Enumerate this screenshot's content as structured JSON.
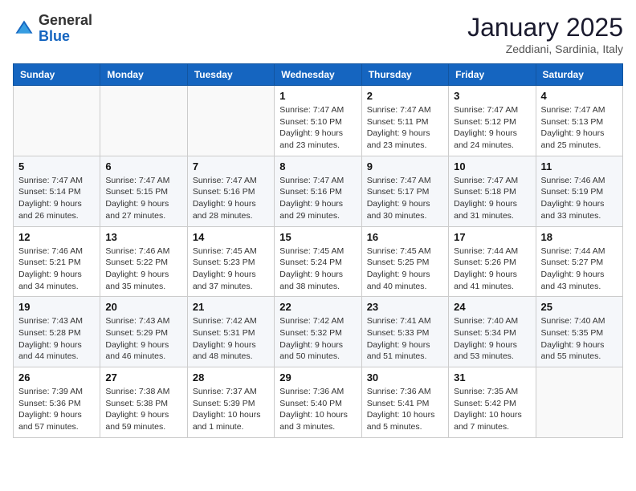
{
  "header": {
    "logo_general": "General",
    "logo_blue": "Blue",
    "month_title": "January 2025",
    "location": "Zeddiani, Sardinia, Italy"
  },
  "weekdays": [
    "Sunday",
    "Monday",
    "Tuesday",
    "Wednesday",
    "Thursday",
    "Friday",
    "Saturday"
  ],
  "weeks": [
    [
      {
        "day": "",
        "info": ""
      },
      {
        "day": "",
        "info": ""
      },
      {
        "day": "",
        "info": ""
      },
      {
        "day": "1",
        "info": "Sunrise: 7:47 AM\nSunset: 5:10 PM\nDaylight: 9 hours and 23 minutes."
      },
      {
        "day": "2",
        "info": "Sunrise: 7:47 AM\nSunset: 5:11 PM\nDaylight: 9 hours and 23 minutes."
      },
      {
        "day": "3",
        "info": "Sunrise: 7:47 AM\nSunset: 5:12 PM\nDaylight: 9 hours and 24 minutes."
      },
      {
        "day": "4",
        "info": "Sunrise: 7:47 AM\nSunset: 5:13 PM\nDaylight: 9 hours and 25 minutes."
      }
    ],
    [
      {
        "day": "5",
        "info": "Sunrise: 7:47 AM\nSunset: 5:14 PM\nDaylight: 9 hours and 26 minutes."
      },
      {
        "day": "6",
        "info": "Sunrise: 7:47 AM\nSunset: 5:15 PM\nDaylight: 9 hours and 27 minutes."
      },
      {
        "day": "7",
        "info": "Sunrise: 7:47 AM\nSunset: 5:16 PM\nDaylight: 9 hours and 28 minutes."
      },
      {
        "day": "8",
        "info": "Sunrise: 7:47 AM\nSunset: 5:16 PM\nDaylight: 9 hours and 29 minutes."
      },
      {
        "day": "9",
        "info": "Sunrise: 7:47 AM\nSunset: 5:17 PM\nDaylight: 9 hours and 30 minutes."
      },
      {
        "day": "10",
        "info": "Sunrise: 7:47 AM\nSunset: 5:18 PM\nDaylight: 9 hours and 31 minutes."
      },
      {
        "day": "11",
        "info": "Sunrise: 7:46 AM\nSunset: 5:19 PM\nDaylight: 9 hours and 33 minutes."
      }
    ],
    [
      {
        "day": "12",
        "info": "Sunrise: 7:46 AM\nSunset: 5:21 PM\nDaylight: 9 hours and 34 minutes."
      },
      {
        "day": "13",
        "info": "Sunrise: 7:46 AM\nSunset: 5:22 PM\nDaylight: 9 hours and 35 minutes."
      },
      {
        "day": "14",
        "info": "Sunrise: 7:45 AM\nSunset: 5:23 PM\nDaylight: 9 hours and 37 minutes."
      },
      {
        "day": "15",
        "info": "Sunrise: 7:45 AM\nSunset: 5:24 PM\nDaylight: 9 hours and 38 minutes."
      },
      {
        "day": "16",
        "info": "Sunrise: 7:45 AM\nSunset: 5:25 PM\nDaylight: 9 hours and 40 minutes."
      },
      {
        "day": "17",
        "info": "Sunrise: 7:44 AM\nSunset: 5:26 PM\nDaylight: 9 hours and 41 minutes."
      },
      {
        "day": "18",
        "info": "Sunrise: 7:44 AM\nSunset: 5:27 PM\nDaylight: 9 hours and 43 minutes."
      }
    ],
    [
      {
        "day": "19",
        "info": "Sunrise: 7:43 AM\nSunset: 5:28 PM\nDaylight: 9 hours and 44 minutes."
      },
      {
        "day": "20",
        "info": "Sunrise: 7:43 AM\nSunset: 5:29 PM\nDaylight: 9 hours and 46 minutes."
      },
      {
        "day": "21",
        "info": "Sunrise: 7:42 AM\nSunset: 5:31 PM\nDaylight: 9 hours and 48 minutes."
      },
      {
        "day": "22",
        "info": "Sunrise: 7:42 AM\nSunset: 5:32 PM\nDaylight: 9 hours and 50 minutes."
      },
      {
        "day": "23",
        "info": "Sunrise: 7:41 AM\nSunset: 5:33 PM\nDaylight: 9 hours and 51 minutes."
      },
      {
        "day": "24",
        "info": "Sunrise: 7:40 AM\nSunset: 5:34 PM\nDaylight: 9 hours and 53 minutes."
      },
      {
        "day": "25",
        "info": "Sunrise: 7:40 AM\nSunset: 5:35 PM\nDaylight: 9 hours and 55 minutes."
      }
    ],
    [
      {
        "day": "26",
        "info": "Sunrise: 7:39 AM\nSunset: 5:36 PM\nDaylight: 9 hours and 57 minutes."
      },
      {
        "day": "27",
        "info": "Sunrise: 7:38 AM\nSunset: 5:38 PM\nDaylight: 9 hours and 59 minutes."
      },
      {
        "day": "28",
        "info": "Sunrise: 7:37 AM\nSunset: 5:39 PM\nDaylight: 10 hours and 1 minute."
      },
      {
        "day": "29",
        "info": "Sunrise: 7:36 AM\nSunset: 5:40 PM\nDaylight: 10 hours and 3 minutes."
      },
      {
        "day": "30",
        "info": "Sunrise: 7:36 AM\nSunset: 5:41 PM\nDaylight: 10 hours and 5 minutes."
      },
      {
        "day": "31",
        "info": "Sunrise: 7:35 AM\nSunset: 5:42 PM\nDaylight: 10 hours and 7 minutes."
      },
      {
        "day": "",
        "info": ""
      }
    ]
  ]
}
